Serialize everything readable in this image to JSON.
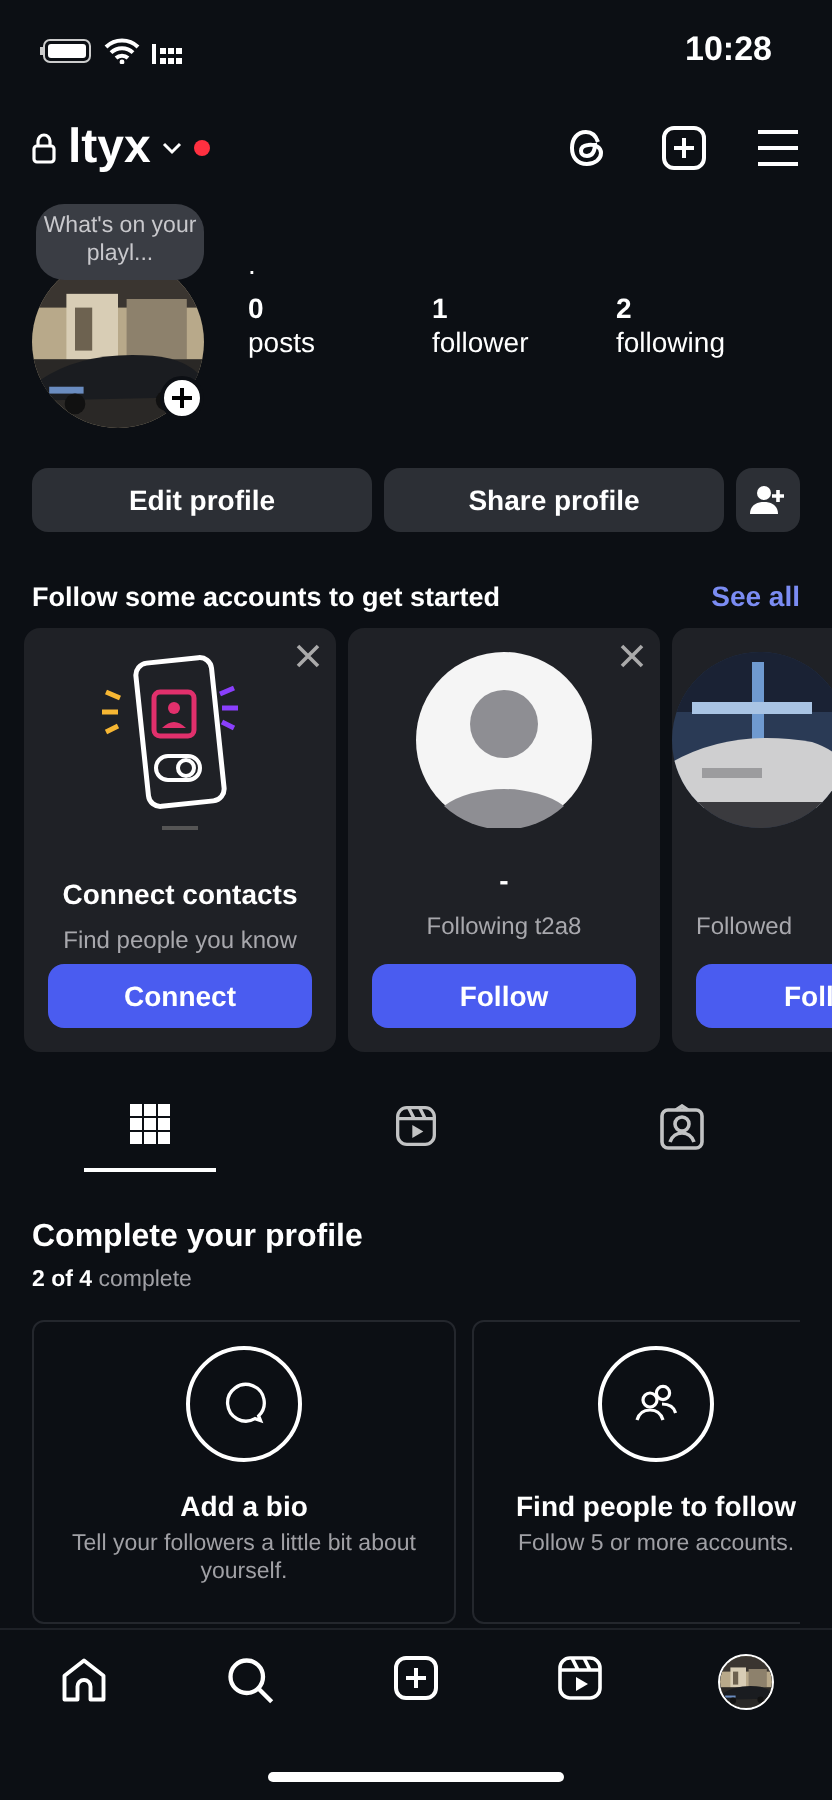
{
  "status_bar": {
    "time": "10:28"
  },
  "header": {
    "username": "ltyx",
    "notification_dot": true
  },
  "profile": {
    "note": "What's on your playl...",
    "name": ".",
    "stats": [
      {
        "value": "0",
        "label": "posts"
      },
      {
        "value": "1",
        "label": "follower"
      },
      {
        "value": "2",
        "label": "following"
      }
    ]
  },
  "buttons": [
    "Edit profile",
    "Share profile"
  ],
  "suggestions": {
    "title": "Follow some accounts to get started",
    "see_all": "See all",
    "cards": [
      {
        "kind": "contacts",
        "title": "Connect contacts",
        "subtitle": "Find people you know",
        "button": "Connect"
      },
      {
        "kind": "person",
        "title": "-",
        "subtitle": "Following t2a8",
        "button": "Follow"
      },
      {
        "subtitle": "Followed",
        "button": "Foll"
      }
    ]
  },
  "tabs": [
    {
      "kind": "grid",
      "selected": true
    },
    {
      "kind": "reels",
      "selected": false
    },
    {
      "kind": "tagged",
      "selected": false
    }
  ],
  "complete": {
    "title": "Complete your profile",
    "progress": "**2 of 4** complete",
    "cards": [
      {
        "kind": "bio",
        "title": "Add a bio",
        "text": "Tell your followers a little bit about yourself."
      },
      {
        "kind": "people",
        "title": "Find people to follow",
        "text": "Follow 5 or more accounts."
      }
    ]
  },
  "bottom_nav": [
    {
      "kind": "home"
    },
    {
      "kind": "search"
    },
    {
      "kind": "create"
    },
    {
      "kind": "reels"
    },
    {
      "kind": "profile"
    }
  ]
}
